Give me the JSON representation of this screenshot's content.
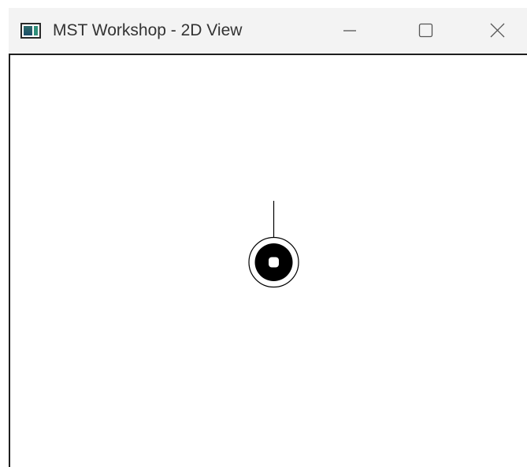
{
  "window": {
    "title": "MST Workshop - 2D View",
    "icon": "app-window-icon",
    "controls": {
      "minimize_icon": "minimize-icon",
      "maximize_icon": "maximize-icon",
      "close_icon": "close-icon"
    }
  },
  "canvas": {
    "background": "#ffffff",
    "node": {
      "outer_ring_color": "#000000",
      "fill_color": "#000000",
      "core_color": "#ffffff",
      "edge_color": "#000000"
    }
  }
}
